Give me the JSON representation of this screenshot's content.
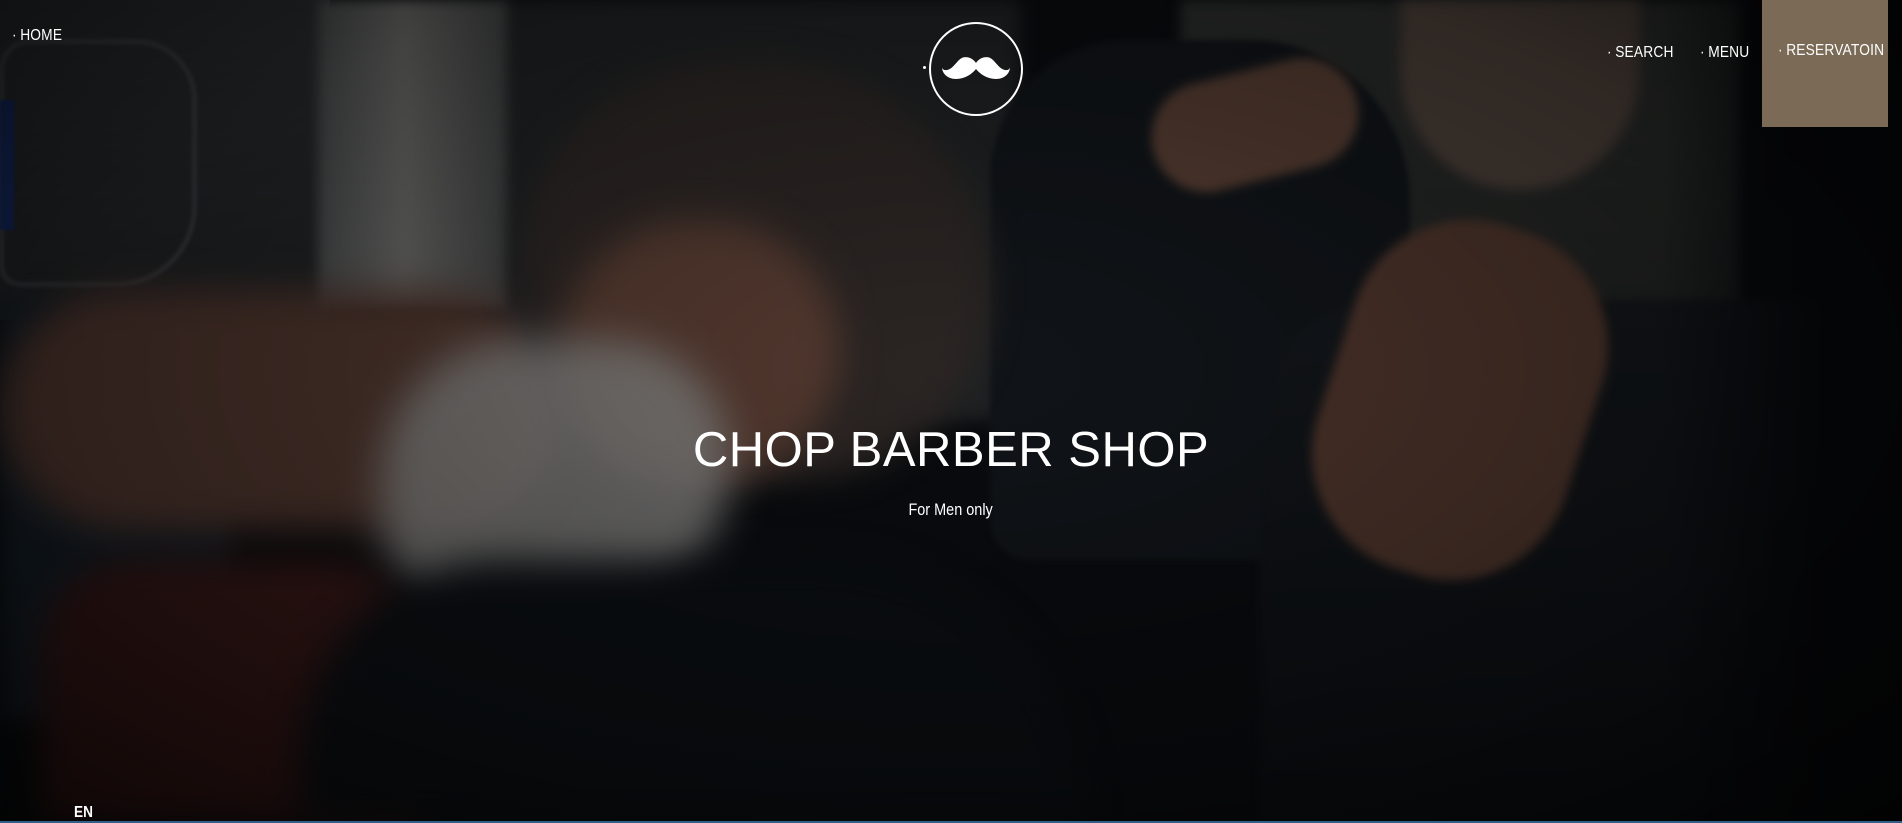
{
  "header": {
    "home_label": "HOME",
    "search_label": "SEARCH",
    "menu_label": "MENU",
    "reservation_label": "RESERVATOIN",
    "bullet": "·",
    "logo_icon": "mustache-icon",
    "reservation_bg_color": "#7a6a56"
  },
  "hero": {
    "title": "CHOP BARBER SHOP",
    "subtitle": "For Men only"
  },
  "footer": {
    "language": "EN"
  }
}
